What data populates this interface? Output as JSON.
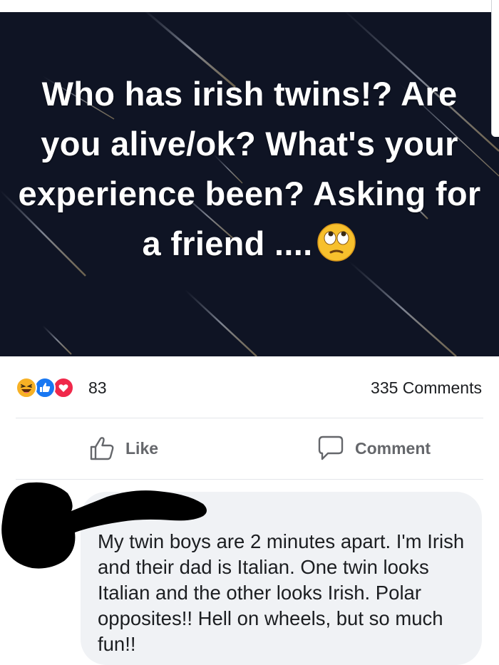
{
  "post": {
    "text": "Who has irish twins!? Are you alive/ok? What's your experience been? Asking for a friend ....",
    "emoji": "face-with-rolling-eyes"
  },
  "reactions": {
    "types": [
      "haha",
      "like",
      "love"
    ],
    "count": "83",
    "comments": "335 Comments"
  },
  "actions": {
    "like_label": "Like",
    "comment_label": "Comment"
  },
  "comment": {
    "text": "My twin boys are 2 minutes apart. I'm Irish and their dad is Italian. One twin looks Italian and the other looks Irish. Polar opposites!! Hell on wheels, but so much fun!!"
  },
  "colors": {
    "post_background": "#0f1424",
    "post_text": "#ffffff",
    "like_blue": "#1877f2",
    "love_red": "#f0284a",
    "haha_yellow": "#f7b125",
    "action_gray": "#65676b",
    "comment_bubble": "#f0f2f5"
  }
}
